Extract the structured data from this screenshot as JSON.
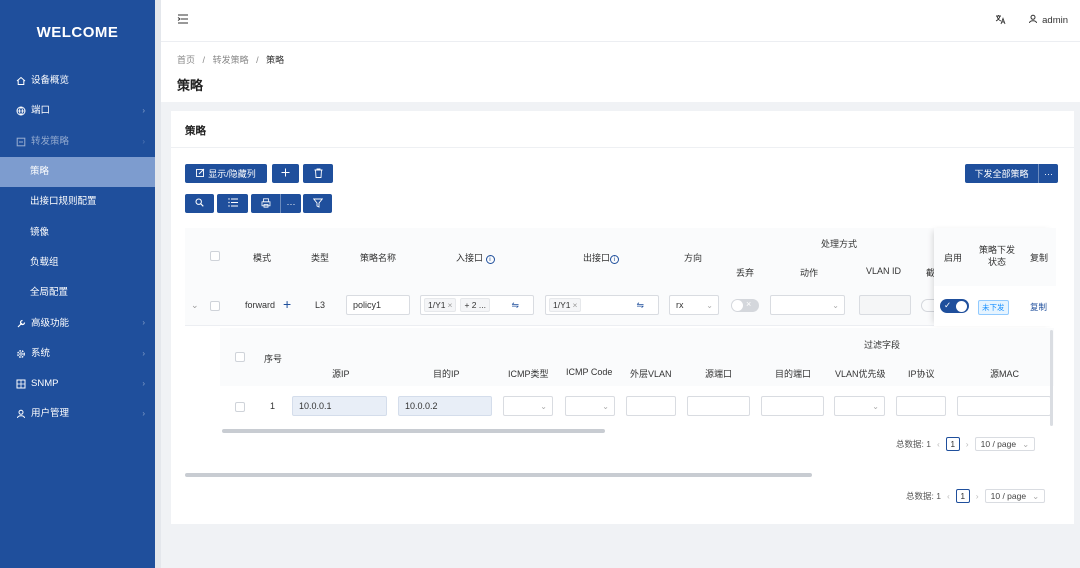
{
  "sidebar": {
    "logo": "WELCOME",
    "items": [
      {
        "label": "设备概览",
        "icon": "home-icon"
      },
      {
        "label": "端口",
        "icon": "globe-icon"
      },
      {
        "label": "转发策略",
        "icon": "forward-icon"
      },
      {
        "label": "策略"
      },
      {
        "label": "出接口规则配置"
      },
      {
        "label": "镜像"
      },
      {
        "label": "负载组"
      },
      {
        "label": "全局配置"
      },
      {
        "label": "高级功能",
        "icon": "wrench-icon"
      },
      {
        "label": "系统",
        "icon": "gear-icon"
      },
      {
        "label": "SNMP",
        "icon": "grid-icon"
      },
      {
        "label": "用户管理",
        "icon": "user-icon"
      }
    ]
  },
  "header": {
    "lang_icon": "translate-icon",
    "user": "admin"
  },
  "breadcrumb": {
    "home": "首页",
    "sep": "/",
    "section": "转发策略",
    "current": "策略"
  },
  "page_title": "策略",
  "card": {
    "title": "策略",
    "toolbar": {
      "toggle_columns": "显示/隐藏列",
      "dispatch_all": "下发全部策略",
      "more": "···"
    }
  },
  "table": {
    "headers": {
      "mode": "模式",
      "type": "类型",
      "name": "策略名称",
      "in_port": "入接口",
      "out_port": "出接口",
      "direction": "方向",
      "handling": "处理方式",
      "drop": "丢弃",
      "action": "动作",
      "vlan_id": "VLAN ID",
      "cut": "截",
      "enable": "启用",
      "dispatch_status": "策略下发状态",
      "copy": "复制"
    },
    "row": {
      "mode": "forward",
      "type": "L3",
      "name": "policy1",
      "in_tag": "1/Y1",
      "in_more": "+ 2 ...",
      "out_tag": "1/Y1",
      "direction": "rx",
      "status": "未下发",
      "copy": "复制"
    }
  },
  "subtable": {
    "headers": {
      "seq": "序号",
      "filter": "过滤字段",
      "src_ip": "源IP",
      "dst_ip": "目的IP",
      "icmp_type": "ICMP类型",
      "icmp_code": "ICMP Code",
      "outer_vlan": "外层VLAN",
      "src_port": "源端口",
      "dst_port": "目的端口",
      "vlan_pri": "VLAN优先级",
      "ip_proto": "IP协议",
      "src_mac": "源MAC"
    },
    "row": {
      "seq": "1",
      "src_ip": "10.0.0.1",
      "dst_ip": "10.0.0.2"
    }
  },
  "pager_inner": {
    "total": "总数据: 1",
    "page": "1",
    "size": "10 / page"
  },
  "pager_outer": {
    "total": "总数据: 1",
    "page": "1",
    "size": "10 / page"
  },
  "colors": {
    "primary": "#1f4f9c",
    "sidebar_active": "#7d9ccf",
    "status_badge": "#1890ff"
  }
}
